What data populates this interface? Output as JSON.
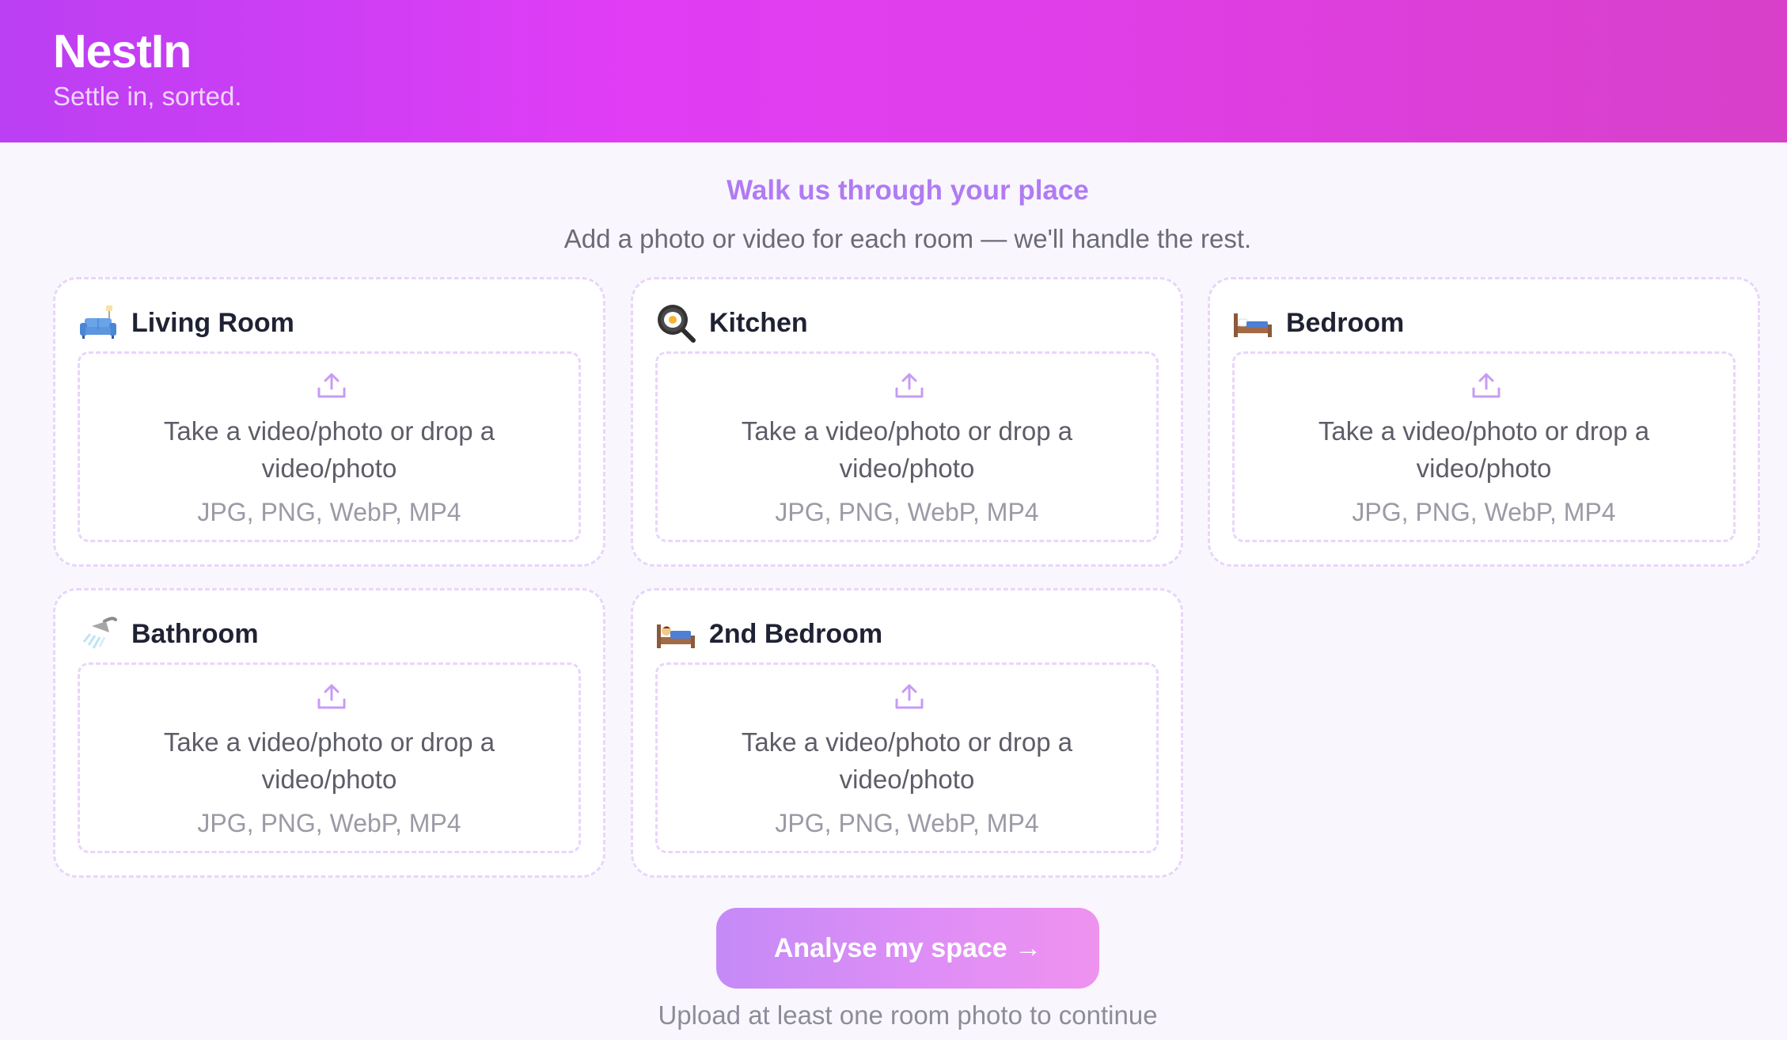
{
  "app": {
    "brand": "NestIn",
    "tagline": "Settle in, sorted."
  },
  "intro": {
    "title": "Walk us through your place",
    "subtitle": "Add a photo or video for each room — we'll handle the rest."
  },
  "rooms": [
    {
      "title": "Living Room",
      "icon": "couch-icon",
      "drop_text": "Take a video/photo or drop a video/photo",
      "formats": "JPG, PNG, WebP, MP4"
    },
    {
      "title": "Kitchen",
      "icon": "frying-pan-icon",
      "drop_text": "Take a video/photo or drop a video/photo",
      "formats": "JPG, PNG, WebP, MP4"
    },
    {
      "title": "Bedroom",
      "icon": "bed-icon",
      "drop_text": "Take a video/photo or drop a video/photo",
      "formats": "JPG, PNG, WebP, MP4"
    },
    {
      "title": "Bathroom",
      "icon": "shower-icon",
      "drop_text": "Take a video/photo or drop a video/photo",
      "formats": "JPG, PNG, WebP, MP4"
    },
    {
      "title": "2nd Bedroom",
      "icon": "sleeping-person-icon",
      "drop_text": "Take a video/photo or drop a video/photo",
      "formats": "JPG, PNG, WebP, MP4"
    }
  ],
  "cta": {
    "label": "Analyse my space →",
    "helper": "Upload at least one room photo to continue"
  },
  "colors": {
    "header_gradient_start": "#bb3ff3",
    "header_gradient_end": "#d840c9",
    "accent_purple": "#b07bf3",
    "card_border": "#e8d6fb",
    "button_gradient_start": "#c58af7",
    "button_gradient_end": "#ef92f0",
    "background": "#f9f7fd"
  }
}
